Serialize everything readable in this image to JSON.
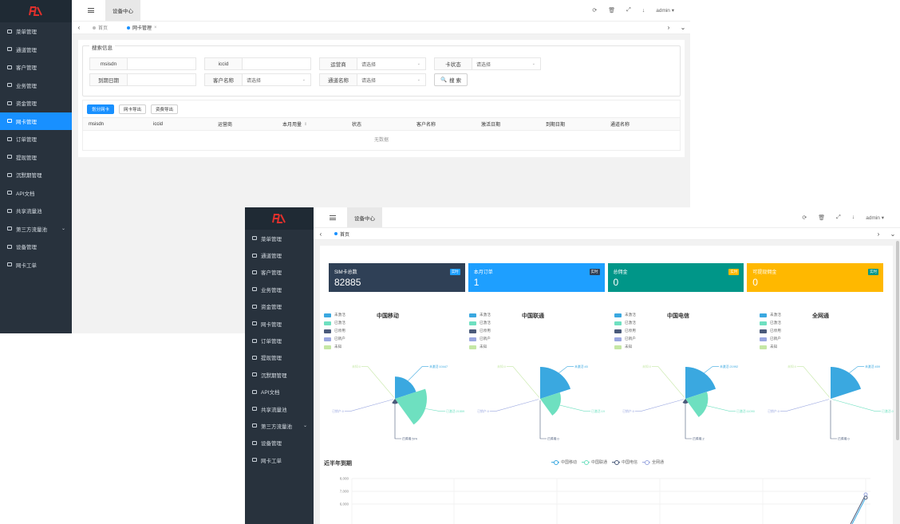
{
  "logo_text": "FL",
  "menu": [
    "菜单管理",
    "通道管理",
    "客户管理",
    "业务管理",
    "资金管理",
    "网卡管理",
    "订单管理",
    "提现管理",
    "沉默期管理",
    "API文档",
    "共享流量池",
    "第三方流量池",
    "设备管理",
    "网卡工单"
  ],
  "header": {
    "tab": "设备中心",
    "user": "admin ▾"
  },
  "window1": {
    "tags": [
      {
        "label": "首页"
      },
      {
        "label": "网卡管理"
      }
    ],
    "search": {
      "legend": "搜索信息",
      "row1": [
        {
          "label": "msisdn",
          "value": ""
        },
        {
          "label": "iccid",
          "value": ""
        },
        {
          "label": "运营商",
          "value": "请选择"
        },
        {
          "label": "卡状态",
          "value": "请选择"
        }
      ],
      "row2": [
        {
          "label": "到期日期",
          "value": ""
        },
        {
          "label": "客户名称",
          "value": "请选择"
        },
        {
          "label": "通道名称",
          "value": "请选择"
        }
      ],
      "search_button": "搜 索"
    },
    "buttons": [
      "划分网卡",
      "网卡导出",
      "资费导出"
    ],
    "table": {
      "columns": [
        "msisdn",
        "iccid",
        "运营商",
        "本月用量",
        "状态",
        "客户名称",
        "激活日期",
        "到期日期",
        "通道名称"
      ],
      "empty": "无数据"
    }
  },
  "window2": {
    "tags": [
      {
        "label": "首页"
      }
    ],
    "stats": [
      {
        "title": "SIM卡总数",
        "value": "82885",
        "badge": "实时",
        "bg": "#2f4056",
        "badge_bg": "#1e9fff"
      },
      {
        "title": "本月订单",
        "value": "1",
        "badge": "实时",
        "bg": "#1e9fff",
        "badge_bg": "#2f4056"
      },
      {
        "title": "总佣金",
        "value": "0",
        "badge": "实时",
        "bg": "#009688",
        "badge_bg": "#ffb800"
      },
      {
        "title": "可提现佣金",
        "value": "0",
        "badge": "实时",
        "bg": "#ffb800",
        "badge_bg": "#009688"
      }
    ],
    "pie_legend": [
      "未激活",
      "已激活",
      "已停用",
      "已销户",
      "未知"
    ],
    "pie_colors": [
      "#3aa8e0",
      "#6ee0c0",
      "#4a5a7a",
      "#9aa7e0",
      "#c5e7a5"
    ],
    "chart_data": [
      {
        "type": "pie",
        "title": "中国移动",
        "labels": [
          "未激活",
          "已激活",
          "已停用",
          "已销户",
          "未知"
        ],
        "values": [
          10447,
          21559,
          574,
          0,
          0
        ],
        "data_labels": [
          "未激活:10447",
          "已激活:21559",
          "已停用:574",
          "已销户:0",
          "未知:0"
        ]
      },
      {
        "type": "pie",
        "title": "中国联通",
        "labels": [
          "未激活",
          "已激活",
          "已停用",
          "已销户",
          "未知"
        ],
        "values": [
          45,
          19,
          0,
          0,
          0
        ],
        "data_labels": [
          "未激活:45",
          "已激活:19",
          "已停用:0",
          "已销户:0",
          "未知:0"
        ]
      },
      {
        "type": "pie",
        "title": "中国电信",
        "labels": [
          "未激活",
          "已激活",
          "已停用",
          "已销户",
          "未知"
        ],
        "values": [
          21992,
          11090,
          2,
          0,
          0
        ],
        "data_labels": [
          "未激活:21992",
          "已激活:11090",
          "已停用:2",
          "已销户:0",
          "未知:0"
        ]
      },
      {
        "type": "pie",
        "title": "全网通",
        "labels": [
          "未激活",
          "已激活",
          "已停用",
          "已销户",
          "未知"
        ],
        "values": [
          459,
          0,
          0,
          0,
          0
        ],
        "data_labels": [
          "未激活:459",
          "已激活:0",
          "已停用:0",
          "已销户:0",
          "未知:0"
        ]
      },
      {
        "type": "line",
        "title": "近半年到期",
        "series": [
          {
            "name": "中国移动",
            "color": "#3aa8e0"
          },
          {
            "name": "中国联通",
            "color": "#6ee0c0"
          },
          {
            "name": "中国电信",
            "color": "#4a5a7a"
          },
          {
            "name": "全网通",
            "color": "#9aa7e0"
          }
        ],
        "y_ticks": [
          "8,000",
          "7,000",
          "6,000"
        ],
        "ylim": [
          6000,
          8000
        ]
      }
    ]
  }
}
